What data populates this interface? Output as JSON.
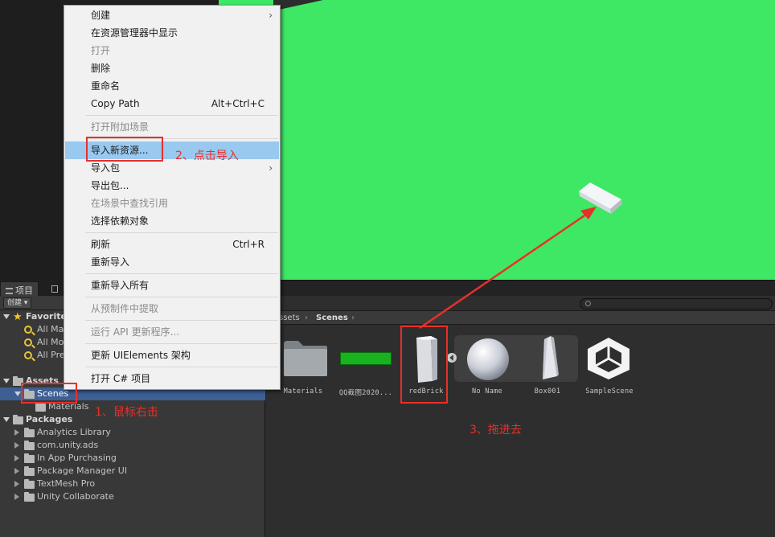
{
  "colors": {
    "scene_green": "#3ee865",
    "selection_blue": "#3d5f93",
    "menu_highlight": "#99c9ef",
    "annotation_red": "#e8302a"
  },
  "panel": {
    "tab_project": "项目",
    "create_dropdown": "创建"
  },
  "tree": {
    "favorites": "Favorite",
    "fav_items": [
      "All Ma",
      "All Mo",
      "All Pre"
    ],
    "assets": "Assets",
    "scenes": "Scenes",
    "materials": "Materials",
    "packages": "Packages",
    "package_items": [
      "Analytics Library",
      "com.unity.ads",
      "In App Purchasing",
      "Package Manager UI",
      "TextMesh Pro",
      "Unity Collaborate"
    ]
  },
  "breadcrumb": {
    "parent": "ssets",
    "current": "Scenes"
  },
  "assets": [
    {
      "label": "Materials",
      "icon": "folder-icon"
    },
    {
      "label": "QQ截图2020...",
      "icon": "image-thumbnail"
    },
    {
      "label": "redBrick",
      "icon": "brick-model-icon"
    },
    {
      "label": "No Name",
      "icon": "sphere-prefab-icon"
    },
    {
      "label": "Box001",
      "icon": "box-model-icon"
    },
    {
      "label": "SampleScene",
      "icon": "unity-scene-icon"
    }
  ],
  "menu": {
    "items": [
      {
        "label": "创建",
        "shortcut": "",
        "submenu": true,
        "disabled": false
      },
      {
        "label": "在资源管理器中显示",
        "shortcut": "",
        "submenu": false,
        "disabled": false
      },
      {
        "label": "打开",
        "shortcut": "",
        "submenu": false,
        "disabled": true
      },
      {
        "label": "删除",
        "shortcut": "",
        "submenu": false,
        "disabled": false
      },
      {
        "label": "重命名",
        "shortcut": "",
        "submenu": false,
        "disabled": false
      },
      {
        "label": "Copy Path",
        "shortcut": "Alt+Ctrl+C",
        "submenu": false,
        "disabled": false
      },
      {
        "label": "打开附加场景",
        "shortcut": "",
        "submenu": false,
        "disabled": true
      },
      {
        "label": "导入新资源...",
        "shortcut": "",
        "submenu": false,
        "disabled": false,
        "highlighted": true
      },
      {
        "label": "导入包",
        "shortcut": "",
        "submenu": true,
        "disabled": false
      },
      {
        "label": "导出包...",
        "shortcut": "",
        "submenu": false,
        "disabled": false
      },
      {
        "label": "在场景中查找引用",
        "shortcut": "",
        "submenu": false,
        "disabled": true
      },
      {
        "label": "选择依赖对象",
        "shortcut": "",
        "submenu": false,
        "disabled": false
      },
      {
        "label": "刷新",
        "shortcut": "Ctrl+R",
        "submenu": false,
        "disabled": false
      },
      {
        "label": "重新导入",
        "shortcut": "",
        "submenu": false,
        "disabled": false
      },
      {
        "label": "重新导入所有",
        "shortcut": "",
        "submenu": false,
        "disabled": false
      },
      {
        "label": "从预制件中提取",
        "shortcut": "",
        "submenu": false,
        "disabled": true
      },
      {
        "label": "运行 API 更新程序...",
        "shortcut": "",
        "submenu": false,
        "disabled": true
      },
      {
        "label": "更新 UIElements 架构",
        "shortcut": "",
        "submenu": false,
        "disabled": false
      },
      {
        "label": "打开 C# 项目",
        "shortcut": "",
        "submenu": false,
        "disabled": false
      }
    ]
  },
  "annotations": {
    "step1": "1、鼠标右击",
    "step2": "2、点击导入",
    "step3": "3、拖进去"
  }
}
